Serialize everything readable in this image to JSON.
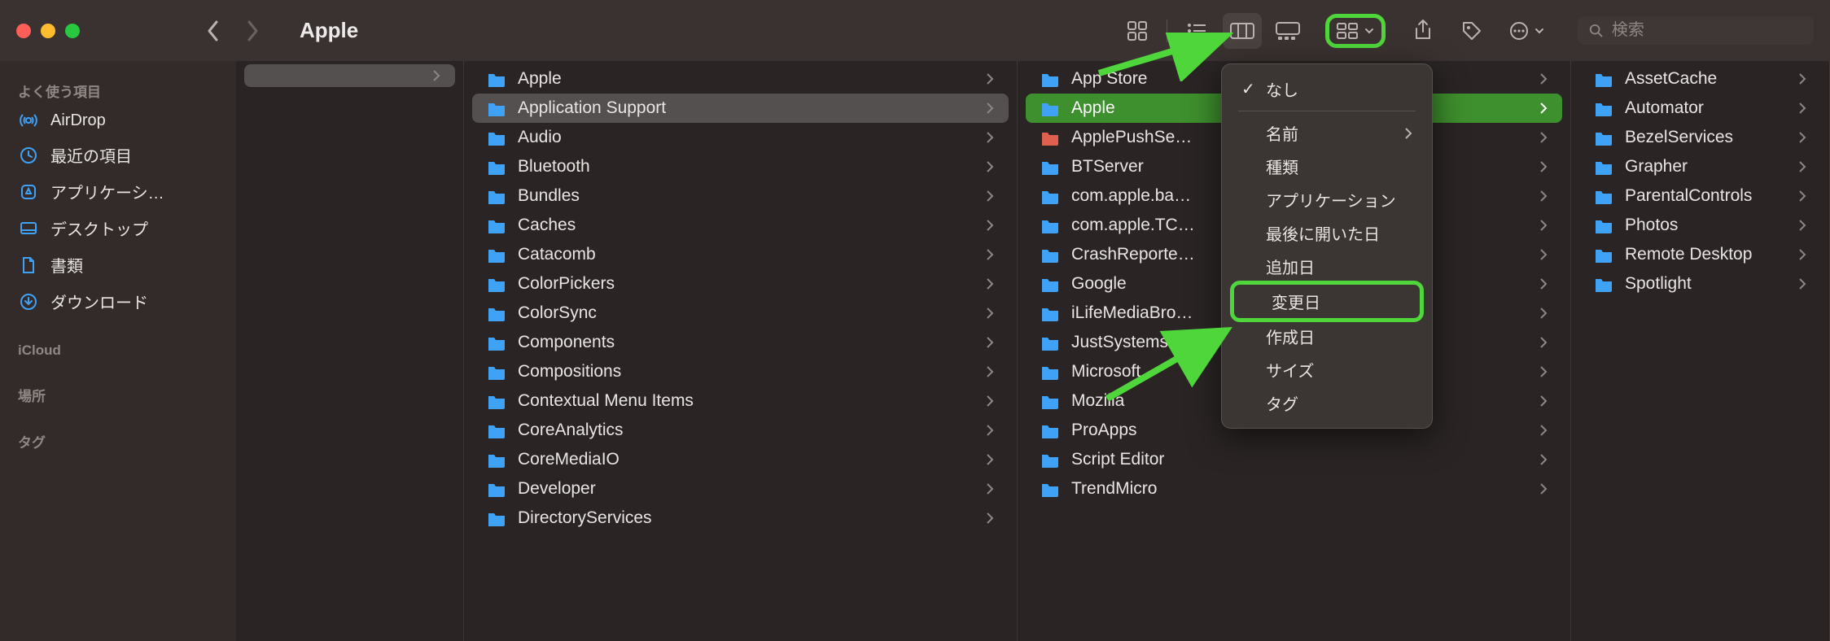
{
  "window": {
    "title": "Apple"
  },
  "search": {
    "placeholder": "検索"
  },
  "sidebar": {
    "sections": [
      {
        "title": "よく使う項目",
        "items": [
          {
            "label": "AirDrop",
            "icon": "airdrop"
          },
          {
            "label": "最近の項目",
            "icon": "clock"
          },
          {
            "label": "アプリケーシ…",
            "icon": "app"
          },
          {
            "label": "デスクトップ",
            "icon": "desktop"
          },
          {
            "label": "書類",
            "icon": "doc"
          },
          {
            "label": "ダウンロード",
            "icon": "download"
          }
        ]
      },
      {
        "title": "iCloud",
        "items": []
      },
      {
        "title": "場所",
        "items": []
      },
      {
        "title": "タグ",
        "items": []
      }
    ]
  },
  "columns": [
    {
      "items": [
        {
          "label": "",
          "blank": true
        }
      ]
    },
    {
      "items": [
        {
          "label": "Apple"
        },
        {
          "label": "Application Support",
          "selected": "out"
        },
        {
          "label": "Audio"
        },
        {
          "label": "Bluetooth"
        },
        {
          "label": "Bundles"
        },
        {
          "label": "Caches"
        },
        {
          "label": "Catacomb"
        },
        {
          "label": "ColorPickers"
        },
        {
          "label": "ColorSync"
        },
        {
          "label": "Components"
        },
        {
          "label": "Compositions"
        },
        {
          "label": "Contextual Menu Items"
        },
        {
          "label": "CoreAnalytics"
        },
        {
          "label": "CoreMediaIO"
        },
        {
          "label": "Developer"
        },
        {
          "label": "DirectoryServices"
        }
      ]
    },
    {
      "items": [
        {
          "label": "App Store"
        },
        {
          "label": "Apple",
          "selected": "active"
        },
        {
          "label": "ApplePushSe…",
          "special_icon": true
        },
        {
          "label": "BTServer"
        },
        {
          "label": "com.apple.ba…"
        },
        {
          "label": "com.apple.TC…"
        },
        {
          "label": "CrashReporte…"
        },
        {
          "label": "Google"
        },
        {
          "label": "iLifeMediaBro…"
        },
        {
          "label": "JustSystems"
        },
        {
          "label": "Microsoft"
        },
        {
          "label": "Mozilla"
        },
        {
          "label": "ProApps"
        },
        {
          "label": "Script Editor"
        },
        {
          "label": "TrendMicro"
        }
      ]
    },
    {
      "items": [
        {
          "label": "AssetCache"
        },
        {
          "label": "Automator"
        },
        {
          "label": "BezelServices"
        },
        {
          "label": "Grapher"
        },
        {
          "label": "ParentalControls"
        },
        {
          "label": "Photos"
        },
        {
          "label": "Remote Desktop"
        },
        {
          "label": "Spotlight"
        }
      ]
    }
  ],
  "menu": {
    "items": [
      {
        "label": "なし",
        "checked": true
      },
      {
        "sep": true
      },
      {
        "label": "名前",
        "submenu": true
      },
      {
        "label": "種類"
      },
      {
        "label": "アプリケーション"
      },
      {
        "label": "最後に開いた日"
      },
      {
        "label": "追加日"
      },
      {
        "label": "変更日",
        "highlight": true
      },
      {
        "label": "作成日"
      },
      {
        "label": "サイズ"
      },
      {
        "label": "タグ"
      }
    ]
  }
}
